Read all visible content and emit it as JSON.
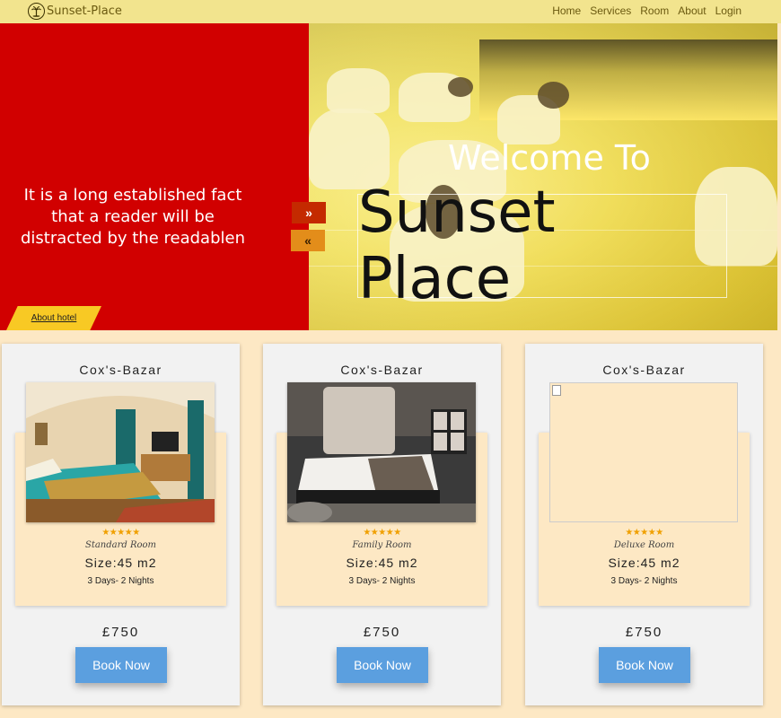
{
  "navbar": {
    "brand": "Sunset-Place",
    "links": [
      "Home",
      "Services",
      "Room",
      "About",
      "Login"
    ]
  },
  "hero": {
    "text": "It is a long established fact that a reader will be distracted by the readablen",
    "about_button": "About hotel",
    "next_icon": "»",
    "prev_icon": "«",
    "welcome": "Welcome To",
    "title": "Sunset Place"
  },
  "cards": [
    {
      "location": "Cox's-Bazar",
      "stars": "★★★★★",
      "room_type": "Standard Room",
      "size": "Size:45 m2",
      "nights": "3 Days- 2 Nights",
      "price": "£750",
      "button": "Book Now"
    },
    {
      "location": "Cox's-Bazar",
      "stars": "★★★★★",
      "room_type": "Family Room",
      "size": "Size:45 m2",
      "nights": "3 Days- 2 Nights",
      "price": "£750",
      "button": "Book Now"
    },
    {
      "location": "Cox's-Bazar",
      "stars": "★★★★★",
      "room_type": "Deluxe Room",
      "size": "Size:45 m2",
      "nights": "3 Days- 2 Nights",
      "price": "£750",
      "button": "Book Now"
    }
  ],
  "colors": {
    "navbar": "#f2e48e",
    "hero_left": "#d10000",
    "about_button": "#f8c924",
    "book_button": "#5b9fdf",
    "page_bg": "#fde8c4"
  }
}
